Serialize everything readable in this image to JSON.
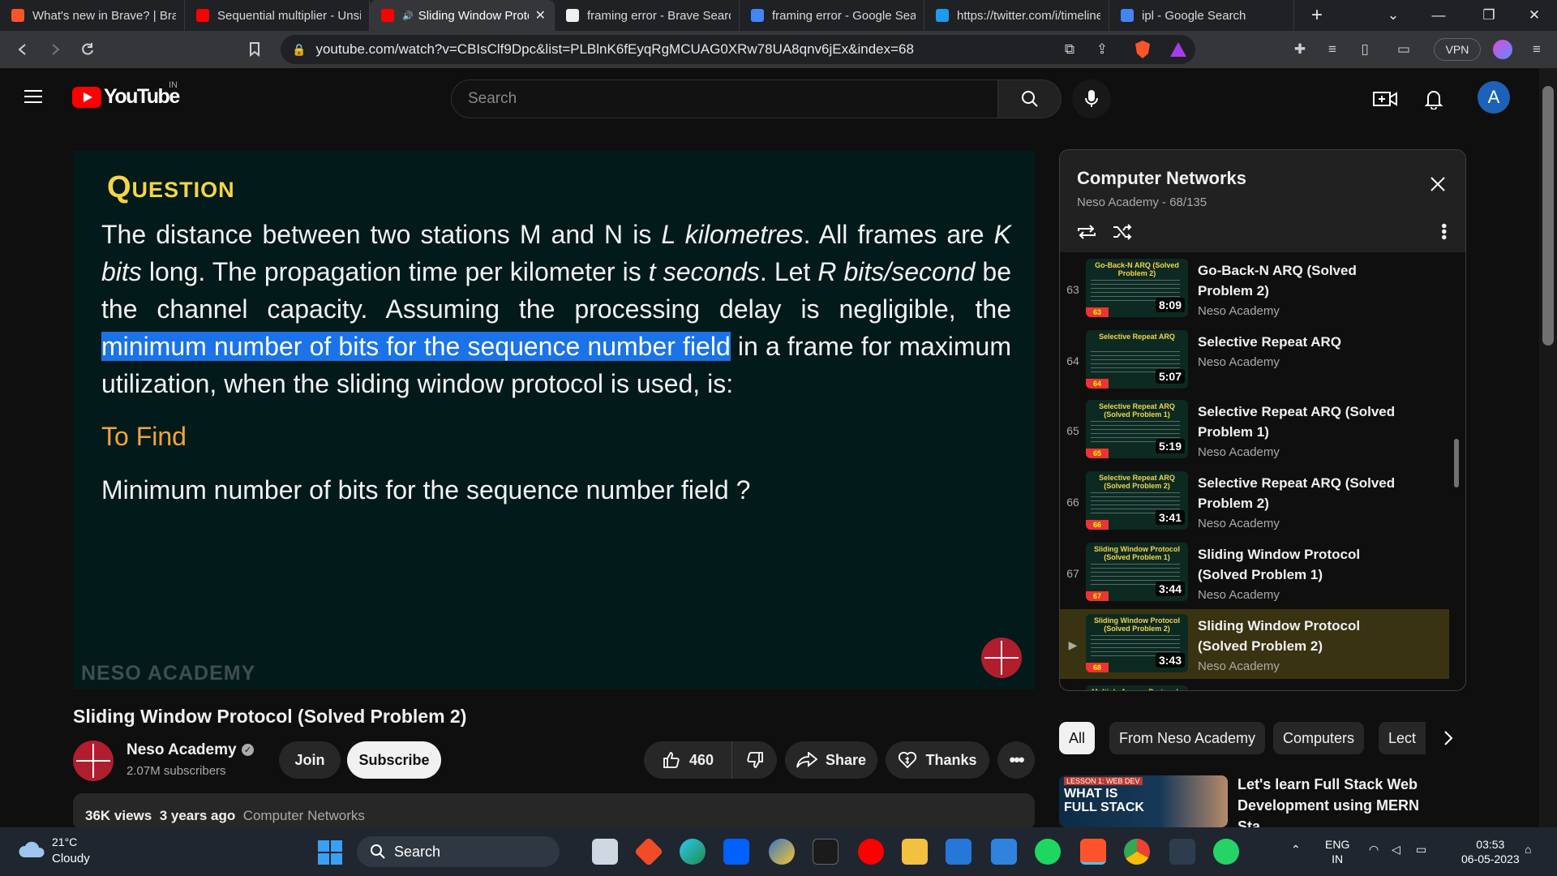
{
  "browser": {
    "tabs": [
      {
        "title": "What's new in Brave? | Brave",
        "icon": "brave-icon",
        "color": "#fb542b"
      },
      {
        "title": "Sequential multiplier - Unsi",
        "icon": "youtube-icon",
        "color": "#ff0000"
      },
      {
        "title": "Sliding Window Protocol",
        "icon": "youtube-icon",
        "color": "#ff0000"
      },
      {
        "title": "framing error - Brave Search",
        "icon": "brave-search-icon",
        "color": "#f0f0f0"
      },
      {
        "title": "framing error - Google Search",
        "icon": "google-icon",
        "color": "#4285f4"
      },
      {
        "title": "https://twitter.com/i/timeline",
        "icon": "twitter-icon",
        "color": "#1d9bf0"
      },
      {
        "title": "ipl - Google Search",
        "icon": "google-icon",
        "color": "#4285f4"
      }
    ],
    "active_tab": 2,
    "url": "youtube.com/watch?v=CBIsClf9Dpc&list=PLBlnK6fEyqRgMCUAG0XRw78UA8qnv6jEx&index=68",
    "brave_shield_count": "99+",
    "rewards_badge": "4",
    "vpn_label": "VPN"
  },
  "youtube": {
    "logo_text": "YouTube",
    "country_code": "IN",
    "search_placeholder": "Search",
    "avatar_letter": "A",
    "accent": "#ff0000"
  },
  "video": {
    "slide": {
      "heading": "Question",
      "body_part1": "The distance between two stations M and N is ",
      "body_L": "L kilometres",
      "body_part2": ". All frames are ",
      "body_K": "K bits",
      "body_part3": " long. The propagation time per kilometer is ",
      "body_t": "t seconds",
      "body_part4": ". Let ",
      "body_R": "R bits/second",
      "body_part5": " be the channel capacity. Assuming the processing delay is negligible, the ",
      "body_highlight": "minimum number of bits for the sequence number field",
      "body_part6": " in a frame for maximum utilization, when the sliding window protocol is used, is:",
      "to_find_label": "To Find",
      "to_find_question": "Minimum number of bits for the sequence number field ?",
      "watermark": "NESO ACADEMY"
    },
    "title": "Sliding Window Protocol (Solved Problem 2)",
    "channel_name": "Neso Academy",
    "subscribers": "2.07M subscribers",
    "join_label": "Join",
    "subscribe_label": "Subscribe",
    "likes": "460",
    "share_label": "Share",
    "thanks_label": "Thanks",
    "views": "36K views",
    "age": "3 years ago",
    "category": "Computer Networks"
  },
  "playlist": {
    "title": "Computer Networks",
    "subtitle": "Neso Academy - 68/135",
    "items": [
      {
        "index": "63",
        "title_line1": "Go-Back-N ARQ (Solved",
        "title_line2": "Problem 2)",
        "channel": "Neso Academy",
        "duration": "8:09",
        "thumb_text": "Go-Back-N ARQ (Solved Problem 2)",
        "thumb_num": "63",
        "active": false
      },
      {
        "index": "64",
        "title_line1": "Selective Repeat ARQ",
        "title_line2": "",
        "channel": "Neso Academy",
        "duration": "5:07",
        "thumb_text": "Selective Repeat ARQ",
        "thumb_num": "64",
        "active": false
      },
      {
        "index": "65",
        "title_line1": "Selective Repeat ARQ (Solved",
        "title_line2": "Problem 1)",
        "channel": "Neso Academy",
        "duration": "5:19",
        "thumb_text": "Selective Repeat ARQ (Solved Problem 1)",
        "thumb_num": "65",
        "active": false
      },
      {
        "index": "66",
        "title_line1": "Selective Repeat ARQ (Solved",
        "title_line2": "Problem 2)",
        "channel": "Neso Academy",
        "duration": "3:41",
        "thumb_text": "Selective Repeat ARQ (Solved Problem 2)",
        "thumb_num": "66",
        "active": false
      },
      {
        "index": "67",
        "title_line1": "Sliding Window Protocol",
        "title_line2": "(Solved Problem 1)",
        "channel": "Neso Academy",
        "duration": "3:44",
        "thumb_text": "Sliding Window Protocol (Solved Problem 1)",
        "thumb_num": "67",
        "active": false
      },
      {
        "index": "▶",
        "title_line1": "Sliding Window Protocol",
        "title_line2": "(Solved Problem 2)",
        "channel": "Neso Academy",
        "duration": "3:43",
        "thumb_text": "Sliding Window Protocol (Solved Problem 2)",
        "thumb_num": "68",
        "active": true
      },
      {
        "index": "",
        "title_line1": "Multiple Access Protocols",
        "title_line2": "",
        "channel": "",
        "duration": "",
        "thumb_text": "Multiple Access Protocols",
        "thumb_num": "",
        "active": false
      }
    ]
  },
  "chips": [
    "All",
    "From Neso Academy",
    "Computers",
    "Lect"
  ],
  "recommendation": {
    "thumb_tag": "LESSON 1: WEB DEV",
    "thumb_text_1": "WHAT IS",
    "thumb_text_2": "FULL STACK",
    "title": "Let's learn Full Stack Web Development using MERN Sta..."
  },
  "taskbar": {
    "temperature": "21°C",
    "condition": "Cloudy",
    "search_label": "Search",
    "language_1": "ENG",
    "language_2": "IN",
    "time": "03:53",
    "date": "06-05-2023"
  }
}
